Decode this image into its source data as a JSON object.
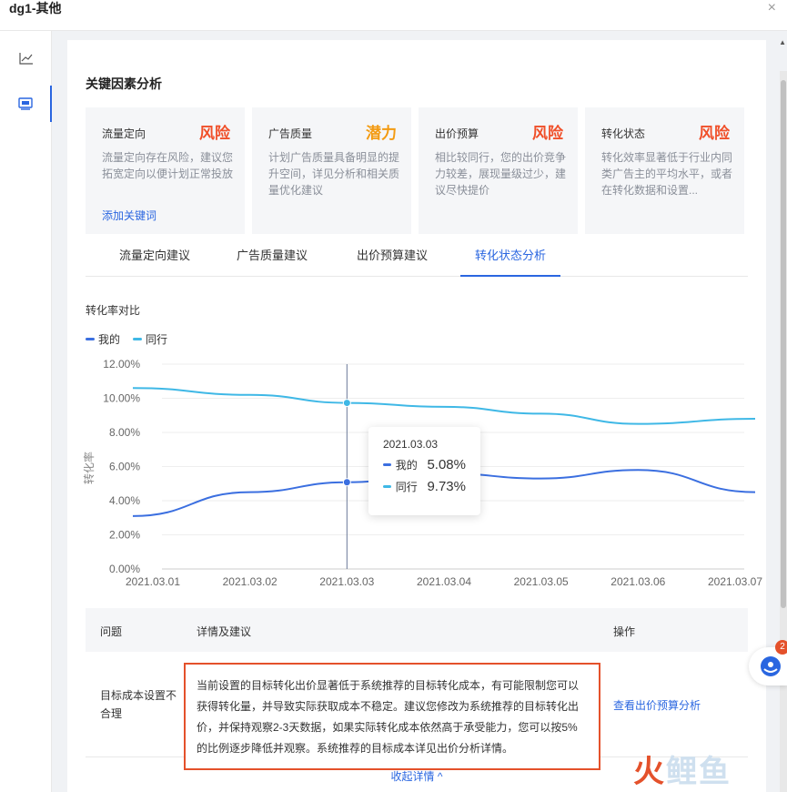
{
  "window": {
    "title": "dg1-其他",
    "close_icon": "×"
  },
  "sidebar": {
    "items": [
      {
        "icon": "line-chart-icon"
      },
      {
        "icon": "report-icon",
        "active": true
      }
    ]
  },
  "section_title": "关键因素分析",
  "colors": {
    "risk": "#f0502a",
    "potential": "#f39b12",
    "accent": "#2a66e0",
    "mine": "#3b6fe0",
    "peer": "#3fb8e6"
  },
  "cards": [
    {
      "name": "流量定向",
      "badge": "风险",
      "badge_type": "risk",
      "desc": "流量定向存在风险，建议您拓宽定向以便计划正常投放",
      "link": "添加关键词"
    },
    {
      "name": "广告质量",
      "badge": "潜力",
      "badge_type": "potential",
      "desc": "计划广告质量具备明显的提升空间，详见分析和相关质量优化建议",
      "link": ""
    },
    {
      "name": "出价预算",
      "badge": "风险",
      "badge_type": "risk",
      "desc": "相比较同行，您的出价竞争力较差，展现量级过少，建议尽快提价",
      "link": ""
    },
    {
      "name": "转化状态",
      "badge": "风险",
      "badge_type": "risk",
      "desc": "转化效率显著低于行业内同类广告主的平均水平，或者在转化数据和设置...",
      "link": ""
    }
  ],
  "tabs": [
    {
      "label": "流量定向建议"
    },
    {
      "label": "广告质量建议"
    },
    {
      "label": "出价预算建议"
    },
    {
      "label": "转化状态分析",
      "active": true
    }
  ],
  "chart_title": "转化率对比",
  "chart_data": {
    "type": "line",
    "title": "转化率对比",
    "ylabel": "转化率",
    "xlabel": "",
    "x": [
      "2021.03.01",
      "2021.03.02",
      "2021.03.03",
      "2021.03.04",
      "2021.03.05",
      "2021.03.06",
      "2021.03.07"
    ],
    "yticks": [
      "0.00%",
      "2.00%",
      "4.00%",
      "6.00%",
      "8.00%",
      "10.00%",
      "12.00%"
    ],
    "ylim": [
      0,
      12
    ],
    "series": [
      {
        "name": "我的",
        "color": "#3b6fe0",
        "values": [
          3.1,
          4.5,
          5.08,
          5.6,
          5.3,
          5.8,
          4.5
        ]
      },
      {
        "name": "同行",
        "color": "#3fb8e6",
        "values": [
          10.6,
          10.2,
          9.73,
          9.5,
          9.1,
          8.5,
          8.8
        ]
      }
    ],
    "grid": true,
    "legend": "top-left"
  },
  "tooltip": {
    "date": "2021.03.03",
    "rows": [
      {
        "label": "我的",
        "value": "5.08%"
      },
      {
        "label": "同行",
        "value": "9.73%"
      }
    ]
  },
  "table": {
    "headers": {
      "issue": "问题",
      "detail": "详情及建议",
      "action": "操作"
    },
    "rows": [
      {
        "issue": "目标成本设置不合理",
        "detail": "当前设置的目标转化出价显著低于系统推荐的目标转化成本，有可能限制您可以获得转化量，并导致实际获取成本不稳定。建议您修改为系统推荐的目标转化出价，并保持观察2-3天数据，如果实际转化成本依然高于承受能力，您可以按5%的比例逐步降低并观察。系统推荐的目标成本详见出价分析详情。",
        "action": "查看出价预算分析"
      }
    ]
  },
  "collapse_label": "收起详情 ^",
  "chat_badge": "2",
  "watermark": {
    "fire": "火",
    "rest": "鲤鱼"
  }
}
